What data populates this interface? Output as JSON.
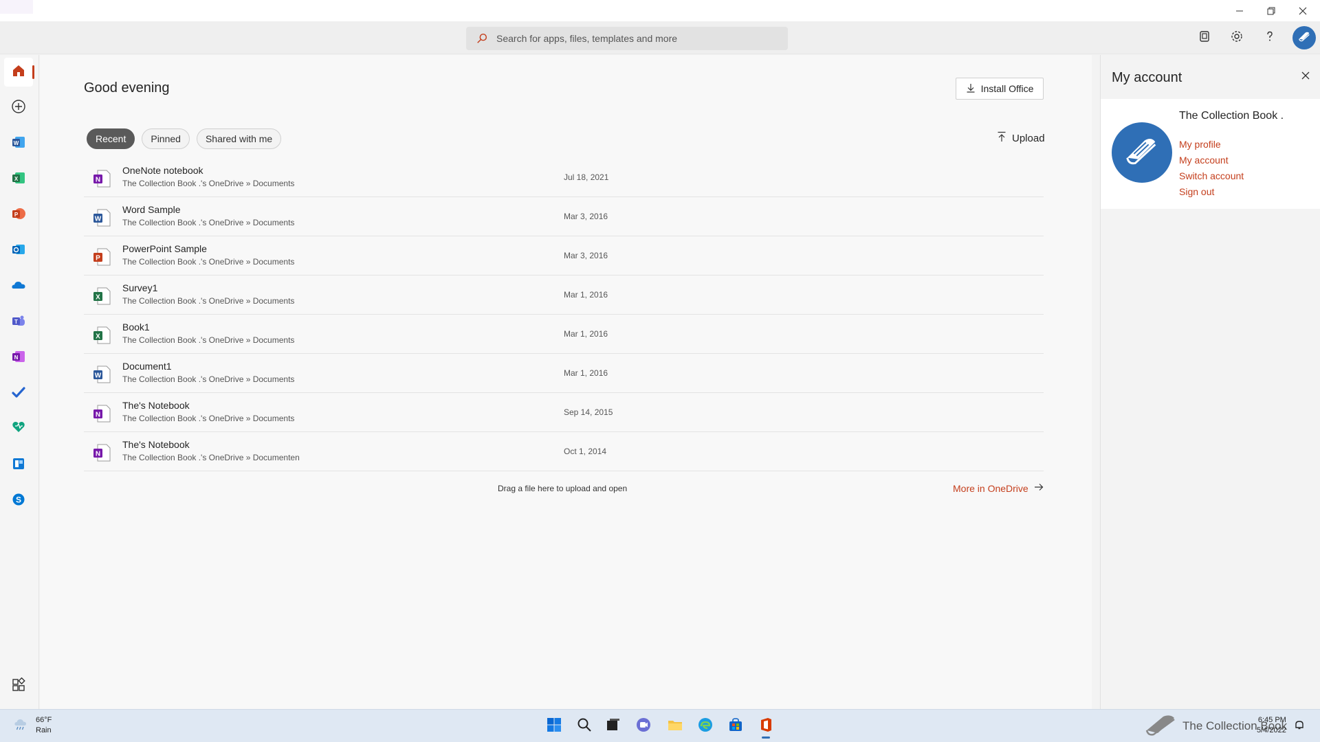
{
  "search": {
    "placeholder": "Search for apps, files, templates and more"
  },
  "greeting": "Good evening",
  "install_button": "Install Office",
  "tabs": [
    {
      "label": "Recent"
    },
    {
      "label": "Pinned"
    },
    {
      "label": "Shared with me"
    }
  ],
  "upload_label": "Upload",
  "files": [
    {
      "name": "OneNote notebook",
      "path": "The Collection Book .'s OneDrive » Documents",
      "date": "Jul 18, 2021",
      "app": "onenote"
    },
    {
      "name": "Word Sample",
      "path": "The Collection Book .'s OneDrive » Documents",
      "date": "Mar 3, 2016",
      "app": "word"
    },
    {
      "name": "PowerPoint Sample",
      "path": "The Collection Book .'s OneDrive » Documents",
      "date": "Mar 3, 2016",
      "app": "powerpoint"
    },
    {
      "name": "Survey1",
      "path": "The Collection Book .'s OneDrive » Documents",
      "date": "Mar 1, 2016",
      "app": "excel"
    },
    {
      "name": "Book1",
      "path": "The Collection Book .'s OneDrive » Documents",
      "date": "Mar 1, 2016",
      "app": "excel"
    },
    {
      "name": "Document1",
      "path": "The Collection Book .'s OneDrive » Documents",
      "date": "Mar 1, 2016",
      "app": "word"
    },
    {
      "name": "The's Notebook",
      "path": "The Collection Book .'s OneDrive » Documents",
      "date": "Sep 14, 2015",
      "app": "onenote"
    },
    {
      "name": "The's Notebook",
      "path": "The Collection Book .'s OneDrive » Documenten",
      "date": "Oct 1, 2014",
      "app": "onenote"
    }
  ],
  "drag_text": "Drag a file here to upload and open",
  "more_link": "More in OneDrive",
  "account": {
    "title": "My account",
    "name": "The Collection Book .",
    "links": [
      "My profile",
      "My account",
      "Switch account",
      "Sign out"
    ]
  },
  "taskbar": {
    "temperature": "66°F",
    "condition": "Rain",
    "tray_label": "The Collection Book",
    "time": "6:45 PM",
    "date": "5/4/2022"
  },
  "colors": {
    "accent": "#c43e1c",
    "word": "#2b579a",
    "excel": "#217346",
    "powerpoint": "#c43e1c",
    "onenote": "#7719aa"
  }
}
